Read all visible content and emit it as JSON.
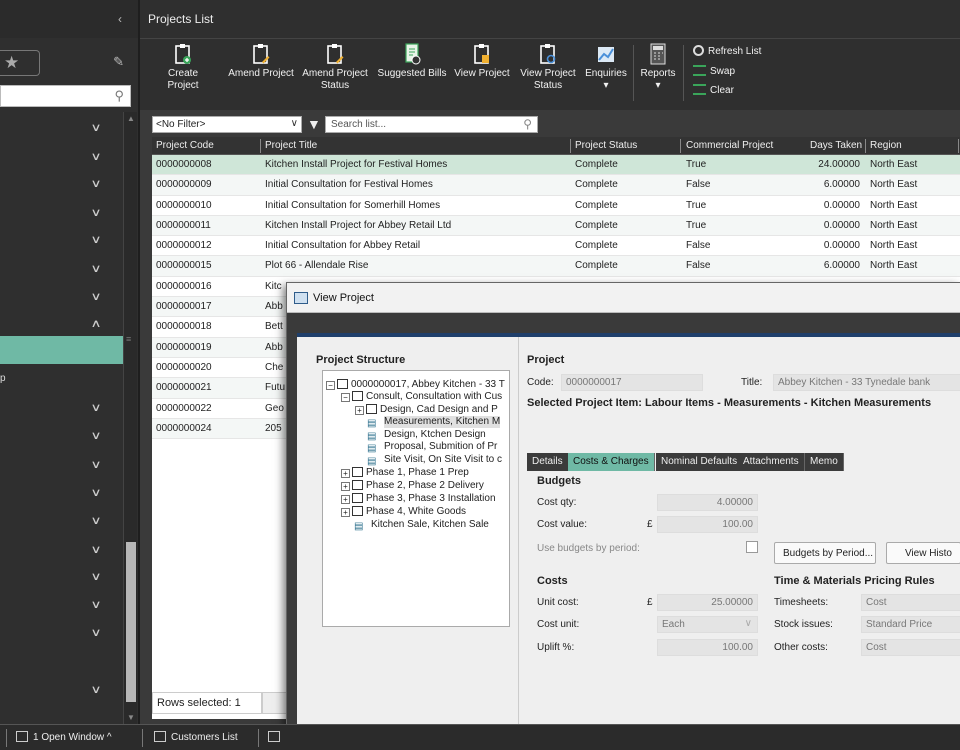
{
  "main": {
    "header_title": "Projects List"
  },
  "toolbar": {
    "create_project": "Create Project",
    "amend_project": "Amend Project",
    "amend_project_status": "Amend Project Status",
    "suggested_bills": "Suggested Bills",
    "view_project": "View Project",
    "view_project_status": "View Project Status",
    "enquiries": "Enquiries",
    "reports": "Reports",
    "refresh_list": "Refresh List",
    "swap": "Swap",
    "clear": "Clear"
  },
  "filter": {
    "selected": "<No Filter>",
    "search_placeholder": "Search list..."
  },
  "grid": {
    "columns": [
      "Project Code",
      "Project Title",
      "Project Status",
      "Commercial Project",
      "Days Taken",
      "Region"
    ],
    "rows": [
      [
        "0000000008",
        "Kitchen Install Project for Festival Homes",
        "Complete",
        "True",
        "24.00000",
        "North East"
      ],
      [
        "0000000009",
        "Initial Consultation for Festival Homes",
        "Complete",
        "False",
        "6.00000",
        "North East"
      ],
      [
        "0000000010",
        "Initial Consultation for Somerhill Homes",
        "Complete",
        "True",
        "0.00000",
        "North East"
      ],
      [
        "0000000011",
        "Kitchen Install Project for Abbey Retail Ltd",
        "Complete",
        "True",
        "0.00000",
        "North East"
      ],
      [
        "0000000012",
        "Initial Consultation for Abbey Retail",
        "Complete",
        "False",
        "0.00000",
        "North East"
      ],
      [
        "0000000015",
        "Plot 66 - Allendale Rise",
        "Complete",
        "False",
        "6.00000",
        "North East"
      ],
      [
        "0000000016",
        "Kitc",
        "",
        "",
        "",
        ""
      ],
      [
        "0000000017",
        "Abb",
        "",
        "",
        "",
        ""
      ],
      [
        "0000000018",
        "Bett",
        "",
        "",
        "",
        ""
      ],
      [
        "0000000019",
        "Abb",
        "",
        "",
        "",
        ""
      ],
      [
        "0000000020",
        "Che",
        "",
        "",
        "",
        ""
      ],
      [
        "0000000021",
        "Futu",
        "",
        "",
        "",
        ""
      ],
      [
        "0000000022",
        "Geo",
        "",
        "",
        "",
        ""
      ],
      [
        "0000000024",
        "205",
        "",
        "",
        "",
        ""
      ]
    ],
    "rows_selected": "Rows selected: 1"
  },
  "sidebar": {
    "partial_label": "p"
  },
  "taskbar": {
    "open_windows": "1 Open Window ^",
    "customers_list": "Customers List"
  },
  "view_project": {
    "window_title": "View Project",
    "structure_title": "Project Structure",
    "tree": [
      "0000000017, Abbey Kitchen - 33 T",
      "Consult, Consultation with Cus",
      "Design, Cad Design and P",
      "Measurements, Kitchen M",
      "Design, Ktchen Design",
      "Proposal, Submition of Pr",
      "Site Visit, On Site Visit to c",
      "Phase 1, Phase 1 Prep",
      "Phase 2, Phase 2 Delivery",
      "Phase 3, Phase 3 Installation",
      "Phase 4, White Goods",
      "Kitchen Sale, Kitchen Sale"
    ],
    "project_heading": "Project",
    "code_label": "Code:",
    "code_value": "0000000017",
    "title_label": "Title:",
    "title_value": "Abbey Kitchen - 33 Tynedale bank",
    "selected_item": "Selected Project Item: Labour Items - Measurements - Kitchen Measurements",
    "tabs": [
      "Details",
      "Costs & Charges",
      "Nominal Defaults",
      "Attachments",
      "Memo"
    ],
    "budgets_heading": "Budgets",
    "cost_qty_label": "Cost qty:",
    "cost_qty_value": "4.00000",
    "cost_value_label": "Cost value:",
    "currency": "£",
    "cost_value_value": "100.00",
    "use_budgets_label": "Use budgets by period:",
    "budgets_by_period_btn": "Budgets by Period...",
    "view_history_btn": "View Histo",
    "costs_heading": "Costs",
    "unit_cost_label": "Unit cost:",
    "unit_cost_value": "25.00000",
    "cost_unit_label": "Cost unit:",
    "cost_unit_value": "Each",
    "uplift_label": "Uplift %:",
    "uplift_value": "100.00",
    "tm_heading": "Time & Materials Pricing Rules",
    "timesheets_label": "Timesheets:",
    "timesheets_value": "Cost",
    "stock_issues_label": "Stock issues:",
    "stock_issues_value": "Standard Price",
    "other_costs_label": "Other costs:",
    "other_costs_value": "Cost"
  }
}
